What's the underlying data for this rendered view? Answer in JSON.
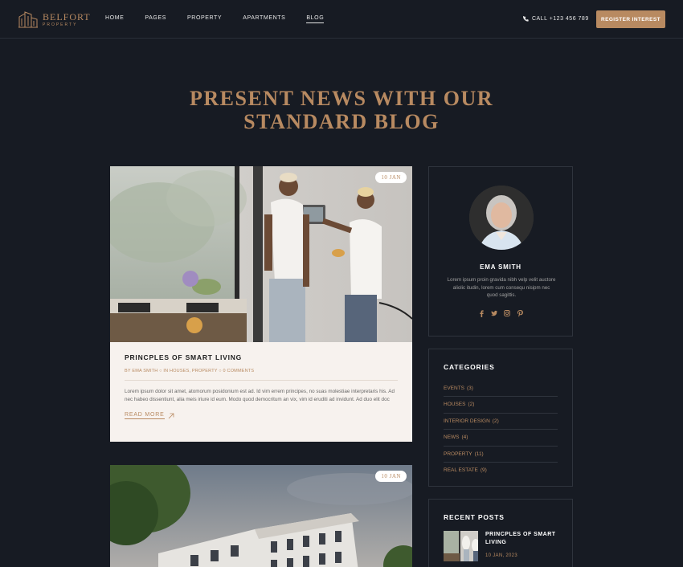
{
  "header": {
    "logo_name": "BELFORT",
    "logo_sub": "PROPERTY",
    "nav": [
      {
        "label": "HOME"
      },
      {
        "label": "PAGES"
      },
      {
        "label": "PROPERTY"
      },
      {
        "label": "APARTMENTS"
      },
      {
        "label": "BLOG"
      }
    ],
    "phone": "CALL +123 456 789",
    "register_label": "REGISTER INTEREST"
  },
  "hero": {
    "line1": "PRESENT NEWS WITH OUR",
    "line2": "STANDARD BLOG"
  },
  "posts": [
    {
      "date": "10 JAN",
      "title": "PRINCPLES OF SMART LIVING",
      "meta": "BY EMA SMITH ○ IN HOUSES, PROPERTY ○ 0 COMMENTS",
      "excerpt": "Lorem ipsum dolor sit amet, atomorum posidonium est ad. Id vim errem principes, no suas molestiae interpretaris his. Ad nec habeo dissentiunt, alia meis iriure id eum. Modo quod democritum an vix, vim id eruditi ad invidunt. Ad duo elit doc",
      "read_more": "READ MORE"
    },
    {
      "date": "10 JAN"
    }
  ],
  "author": {
    "name": "EMA SMITH",
    "bio": "Lorem ipsum proin gravida nibh velp velit auctore aliolic itudin, lorem cum consequ nisipm nec quod sagittis."
  },
  "categories": {
    "title": "CATEGORIES",
    "items": [
      {
        "label": "EVENTS",
        "count": "(3)"
      },
      {
        "label": "HOUSES",
        "count": "(2)"
      },
      {
        "label": "INTERIOR DESIGN",
        "count": "(2)"
      },
      {
        "label": "NEWS",
        "count": "(4)"
      },
      {
        "label": "PROPERTY",
        "count": "(11)"
      },
      {
        "label": "REAL ESTATE",
        "count": "(9)"
      }
    ]
  },
  "recent_posts": {
    "title": "RECENT POSTS",
    "items": [
      {
        "title": "PRINCPLES OF SMART LIVING",
        "date": "10 JAN, 2023"
      }
    ]
  },
  "colors": {
    "background": "#171b23",
    "accent": "#b88a61",
    "card": "#f7f2ee"
  }
}
